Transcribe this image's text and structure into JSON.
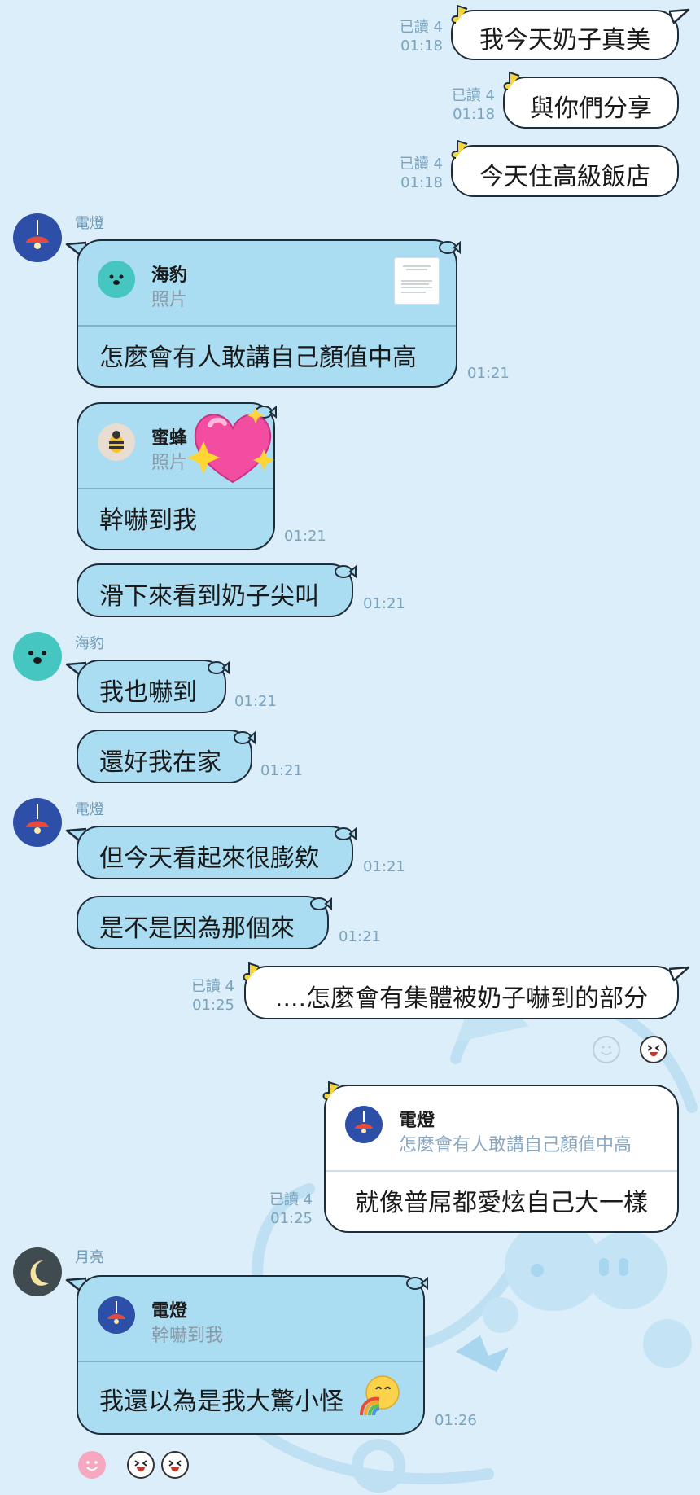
{
  "colors": {
    "background": "#dbeef9",
    "bubble_in": "#aadcf2",
    "bubble_out": "#ffffff",
    "meta": "#7aa3bd"
  },
  "messages": [
    {
      "text": "我今天奶子真美",
      "read": "已讀 4",
      "time": "01:18"
    },
    {
      "text": "與你們分享",
      "read": "已讀 4",
      "time": "01:18"
    },
    {
      "text": "今天住高級飯店",
      "read": "已讀 4",
      "time": "01:18"
    },
    {
      "sender": "電燈",
      "quote_name": "海豹",
      "quote_text": "照片",
      "text": "怎麼會有人敢講自己顏值中高",
      "time": "01:21"
    },
    {
      "quote_name": "蜜蜂",
      "quote_text": "照片",
      "text": "幹嚇到我",
      "time": "01:21",
      "sticker": "sparkling-heart"
    },
    {
      "text": "滑下來看到奶子尖叫",
      "time": "01:21"
    },
    {
      "sender": "海豹",
      "text": "我也嚇到",
      "time": "01:21"
    },
    {
      "text": "還好我在家",
      "time": "01:21"
    },
    {
      "sender": "電燈",
      "text": "但今天看起來很膨欸",
      "time": "01:21"
    },
    {
      "text": "是不是因為那個來",
      "time": "01:21"
    },
    {
      "text": "....怎麼會有集體被奶子嚇到的部分",
      "read": "已讀 4",
      "time": "01:25"
    },
    {
      "quote_name": "電燈",
      "quote_text": "怎麼會有人敢講自己顏值中高",
      "text": "就像普屌都愛炫自己大一樣",
      "read": "已讀 4",
      "time": "01:25"
    },
    {
      "sender": "月亮",
      "quote_name": "電燈",
      "quote_text": "幹嚇到我",
      "text": "我還以為是我大驚小怪",
      "time": "01:26",
      "emoji": "rainbow-face"
    }
  ]
}
